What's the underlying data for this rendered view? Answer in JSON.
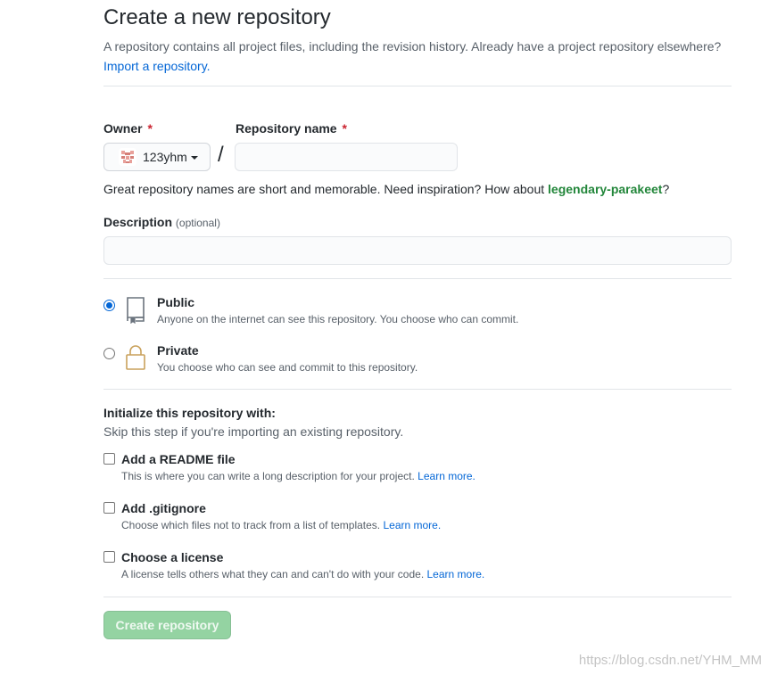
{
  "header": {
    "title": "Create a new repository",
    "description": "A repository contains all project files, including the revision history. Already have a project repository elsewhere?",
    "import_link": "Import a repository."
  },
  "owner": {
    "label": "Owner",
    "required_mark": "*",
    "value": "123yhm",
    "avatar_icon": "identicon-avatar"
  },
  "repo_name": {
    "label": "Repository name",
    "required_mark": "*",
    "value": "",
    "separator": "/"
  },
  "name_hint": {
    "text": "Great repository names are short and memorable. Need inspiration? How about",
    "suggestion": "legendary-parakeet",
    "suffix": "?"
  },
  "description_field": {
    "label": "Description",
    "optional_label": "(optional)",
    "value": ""
  },
  "visibility": {
    "options": [
      {
        "title": "Public",
        "description": "Anyone on the internet can see this repository. You choose who can commit.",
        "icon": "repo-icon",
        "selected": true
      },
      {
        "title": "Private",
        "description": "You choose who can see and commit to this repository.",
        "icon": "lock-icon",
        "selected": false
      }
    ]
  },
  "initialize": {
    "title": "Initialize this repository with:",
    "subtitle": "Skip this step if you're importing an existing repository.",
    "options": [
      {
        "title": "Add a README file",
        "description": "This is where you can write a long description for your project.",
        "learn_more": "Learn more.",
        "checked": false
      },
      {
        "title": "Add .gitignore",
        "description": "Choose which files not to track from a list of templates.",
        "learn_more": "Learn more.",
        "checked": false
      },
      {
        "title": "Choose a license",
        "description": "A license tells others what they can and can't do with your code.",
        "learn_more": "Learn more.",
        "checked": false
      }
    ]
  },
  "submit": {
    "label": "Create repository",
    "disabled": true
  },
  "watermark": "https://blog.csdn.net/YHM_MM",
  "colors": {
    "link": "#0366d6",
    "suggestion": "#22863a",
    "required": "#cb2431",
    "button_disabled": "#94d3a2",
    "radio_selected": "#0366d6"
  }
}
